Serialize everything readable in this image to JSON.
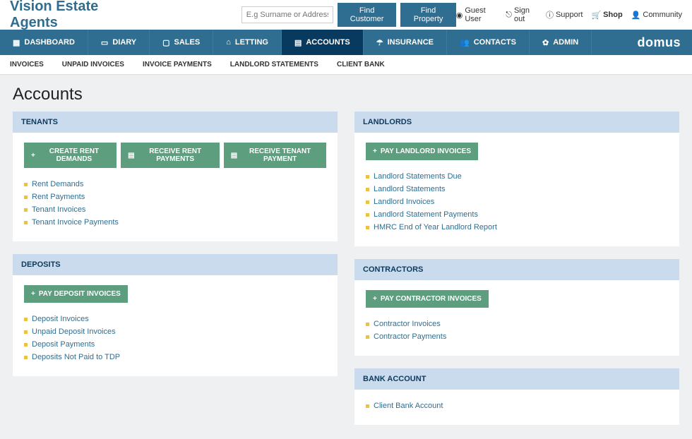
{
  "brand": "Vision Estate Agents",
  "search": {
    "placeholder": "E.g Surname or Address"
  },
  "topbuttons": {
    "find_customer": "Find Customer",
    "find_property": "Find Property"
  },
  "toplinks": {
    "guest": "Guest User",
    "signout": "Sign out",
    "support": "Support",
    "shop": "Shop",
    "community": "Community"
  },
  "nav": {
    "dashboard": "DASHBOARD",
    "diary": "DIARY",
    "sales": "SALES",
    "letting": "LETTING",
    "accounts": "ACCOUNTS",
    "insurance": "INSURANCE",
    "contacts": "CONTACTS",
    "admin": "ADMIN"
  },
  "logo": "domus",
  "subnav": {
    "invoices": "INVOICES",
    "unpaid": "UNPAID INVOICES",
    "payments": "INVOICE PAYMENTS",
    "landlord": "LANDLORD STATEMENTS",
    "clientbank": "CLIENT BANK"
  },
  "page_title": "Accounts",
  "tenants": {
    "title": "TENANTS",
    "btn_create": "CREATE RENT DEMANDS",
    "btn_receive_rent": "RECEIVE RENT PAYMENTS",
    "btn_receive_tenant": "RECEIVE TENANT PAYMENT",
    "links": {
      "l0": "Rent Demands",
      "l1": "Rent Payments",
      "l2": "Tenant Invoices",
      "l3": "Tenant Invoice Payments"
    }
  },
  "deposits": {
    "title": "DEPOSITS",
    "btn_pay": "PAY DEPOSIT INVOICES",
    "links": {
      "l0": "Deposit Invoices",
      "l1": "Unpaid Deposit Invoices",
      "l2": "Deposit Payments",
      "l3": "Deposits Not Paid to TDP"
    }
  },
  "landlords": {
    "title": "LANDLORDS",
    "btn_pay": "PAY LANDLORD INVOICES",
    "links": {
      "l0": "Landlord Statements Due",
      "l1": "Landlord Statements",
      "l2": "Landlord Invoices",
      "l3": "Landlord Statement Payments",
      "l4": "HMRC End of Year Landlord Report"
    }
  },
  "contractors": {
    "title": "CONTRACTORS",
    "btn_pay": "PAY CONTRACTOR INVOICES",
    "links": {
      "l0": "Contractor Invoices",
      "l1": "Contractor Payments"
    }
  },
  "bank": {
    "title": "BANK ACCOUNT",
    "links": {
      "l0": "Client Bank Account"
    }
  }
}
